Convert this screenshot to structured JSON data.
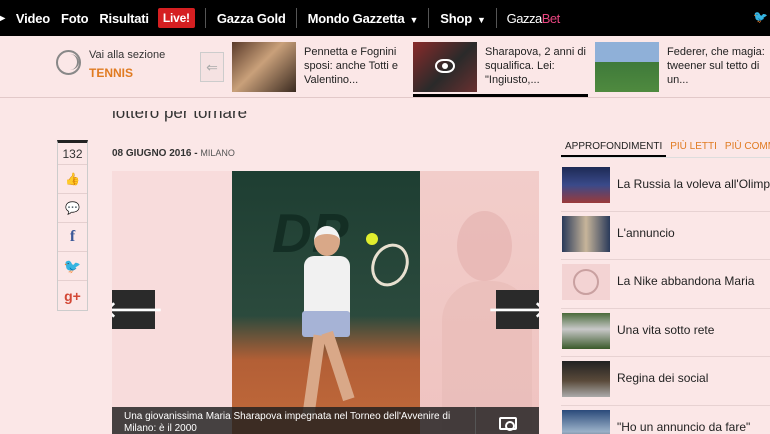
{
  "nav": {
    "items": [
      "Video",
      "Foto",
      "Risultati"
    ],
    "live": "Live!",
    "gold": "Gazza Gold",
    "mondo": "Mondo Gazzetta",
    "shop": "Shop",
    "gazzabet_a": "Gazza",
    "gazzabet_b": "Bet"
  },
  "section": {
    "label": "Vai alla sezione",
    "name": "TENNIS"
  },
  "stories": [
    {
      "text": "Pennetta e Fognini sposi: anche Totti e Valentino..."
    },
    {
      "text": "Sharapova, 2 anni di squalifica. Lei: \"Ingiusto,..."
    },
    {
      "text": "Federer, che magia: tweener sul tetto di un..."
    }
  ],
  "headline": "lottero per tornare",
  "social": {
    "count": "132"
  },
  "date": {
    "day": "08 GIUGNO 2016",
    "sep": " - ",
    "city": "MILANO"
  },
  "gallery": {
    "caption": "Una giovanissima Maria Sharapova impegnata nel Torneo dell'Avvenire di Milano: è il 2000",
    "letters": "DP"
  },
  "sidebar": {
    "tabs": [
      "APPROFONDIMENTI",
      "PIÙ LETTI",
      "PIÙ COMMENTATI"
    ],
    "items": [
      {
        "text": "La Russia la voleva all'Olimpiade"
      },
      {
        "text": "L'annuncio"
      },
      {
        "text": "La Nike abbandona Maria"
      },
      {
        "text": "Una vita sotto rete"
      },
      {
        "text": "Regina dei social"
      },
      {
        "text": "\"Ho un annuncio da fare\""
      }
    ]
  },
  "colors": {
    "accent": "#e07b21",
    "live": "#d51f21",
    "background": "#fbe7e7"
  }
}
